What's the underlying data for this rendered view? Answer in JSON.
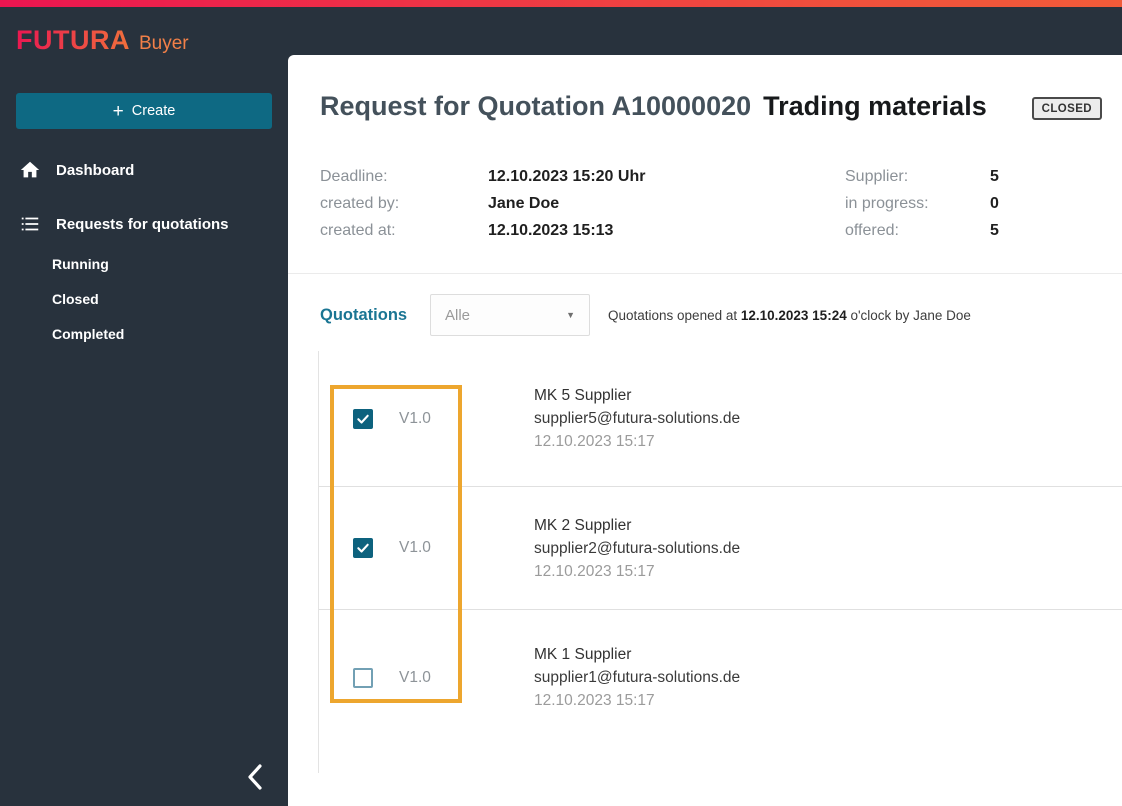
{
  "brand": {
    "name": "FUTURA",
    "product": "Buyer"
  },
  "sidebar": {
    "create_button": {
      "icon": "plus-icon",
      "plus": "+",
      "label": "Create"
    },
    "nav": [
      {
        "label": "Dashboard",
        "icon": "home-icon"
      },
      {
        "label": "Requests for quotations",
        "icon": "list-icon"
      }
    ],
    "subnav": [
      {
        "label": "Running"
      },
      {
        "label": "Closed"
      },
      {
        "label": "Completed"
      }
    ],
    "collapse_icon": "chevron-left-icon"
  },
  "main": {
    "title": {
      "rfq": "Request for Quotation A10000020",
      "name": "Trading materials",
      "status": "CLOSED"
    },
    "details_left": [
      {
        "label": "Deadline:",
        "value": "12.10.2023 15:20 Uhr"
      },
      {
        "label": "created by:",
        "value": "Jane Doe"
      },
      {
        "label": "created at:",
        "value": "12.10.2023 15:13"
      }
    ],
    "details_right": [
      {
        "label": "Supplier:",
        "value": "5"
      },
      {
        "label": "in progress:",
        "value": "0"
      },
      {
        "label": "offered:",
        "value": "5"
      }
    ],
    "quotations": {
      "heading": "Quotations",
      "filter": {
        "value": "Alle",
        "arrow": "▼"
      },
      "note": {
        "prefix": "Quotations opened at ",
        "bold": "12.10.2023 15:24",
        "suffix": " o'clock by Jane Doe"
      },
      "rows": [
        {
          "checked": true,
          "version": "V1.0",
          "name": "MK 5 Supplier",
          "email": "supplier5@futura-solutions.de",
          "date": "12.10.2023 15:17"
        },
        {
          "checked": true,
          "version": "V1.0",
          "name": "MK 2 Supplier",
          "email": "supplier2@futura-solutions.de",
          "date": "12.10.2023 15:17"
        },
        {
          "checked": false,
          "version": "V1.0",
          "name": "MK 1 Supplier",
          "email": "supplier1@futura-solutions.de",
          "date": "12.10.2023 15:17"
        }
      ]
    }
  },
  "colors": {
    "topbar_gradient_start": "#ec1550",
    "topbar_gradient_end": "#f15b39",
    "sidebar_dark": "#28323d",
    "accent_teal": "#0e6983",
    "heading_teal": "#1a7593",
    "annotation_orange": "#eda62e",
    "badge_bg": "#ececec"
  }
}
